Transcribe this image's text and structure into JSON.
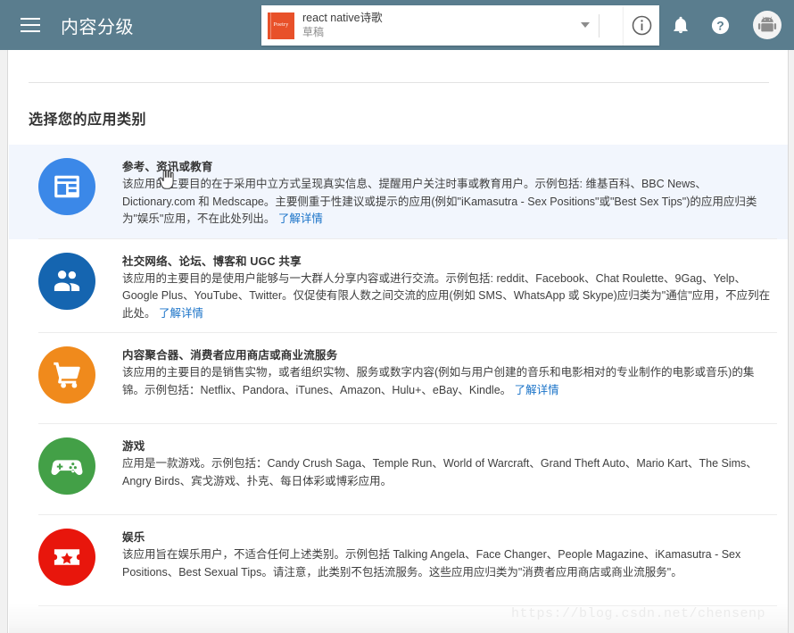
{
  "header": {
    "menu_icon": "hamburger-menu-icon",
    "title": "内容分级",
    "app_selector": {
      "thumb_label": "Poetry",
      "app_name": "react native诗歌",
      "app_status": "草稿",
      "dropdown_icon": "chevron-down-icon"
    },
    "info_icon": "info-icon",
    "notifications_icon": "bell-icon",
    "help_icon": "help-question-icon",
    "account_icon": "android-avatar-icon",
    "bg_color": "#5a7d8e"
  },
  "main": {
    "section_title": "选择您的应用类别",
    "learn_more_label": "了解详情",
    "categories": [
      {
        "id": "reference-news-education",
        "icon": "article-icon",
        "icon_color": "#3b88e8",
        "name": "参考、资讯或教育",
        "desc": "该应用的主要目的在于采用中立方式呈现真实信息、提醒用户关注时事或教育用户。示例包括: 维基百科、BBC News、Dictionary.com 和 Medscape。主要侧重于性建议或提示的应用(例如\"iKamasutra - Sex Positions\"或\"Best Sex Tips\")的应用应归类为\"娱乐\"应用，不在此处列出。",
        "has_link": true,
        "selected": true
      },
      {
        "id": "social-networking",
        "icon": "people-icon",
        "icon_color": "#1565b0",
        "name": "社交网络、论坛、博客和 UGC 共享",
        "desc": "该应用的主要目的是使用户能够与一大群人分享内容或进行交流。示例包括: reddit、Facebook、Chat Roulette、9Gag、Yelp、Google Plus、YouTube、Twitter。仅促使有限人数之间交流的应用(例如 SMS、WhatsApp 或 Skype)应归类为\"通信\"应用，不应列在此处。",
        "has_link": true,
        "selected": false
      },
      {
        "id": "content-aggregator-store",
        "icon": "shopping-cart-icon",
        "icon_color": "#f08a1c",
        "name": "内容聚合器、消费者应用商店或商业流服务",
        "desc": "该应用的主要目的是销售实物，或者组织实物、服务或数字内容(例如与用户创建的音乐和电影相对的专业制作的电影或音乐)的集锦。示例包括：Netflix、Pandora、iTunes、Amazon、Hulu+、eBay、Kindle。",
        "has_link": true,
        "selected": false
      },
      {
        "id": "games",
        "icon": "gamepad-icon",
        "icon_color": "#43a047",
        "name": "游戏",
        "desc": "应用是一款游戏。示例包括：Candy Crush Saga、Temple Run、World of Warcraft、Grand Theft Auto、Mario Kart、The Sims、Angry Birds、宾戈游戏、扑克、每日体彩或博彩应用。",
        "has_link": false,
        "selected": false
      },
      {
        "id": "entertainment",
        "icon": "ticket-star-icon",
        "icon_color": "#e8160c",
        "name": "娱乐",
        "desc": "该应用旨在娱乐用户，不适合任何上述类别。示例包括 Talking Angela、Face Changer、People Magazine、iKamasutra - Sex Positions、Best Sexual Tips。请注意，此类别不包括流服务。这些应用应归类为\"消费者应用商店或商业流服务\"。",
        "has_link": false,
        "selected": false
      }
    ]
  },
  "watermark": {
    "text": "https://blog.csdn.net/chensenp"
  }
}
